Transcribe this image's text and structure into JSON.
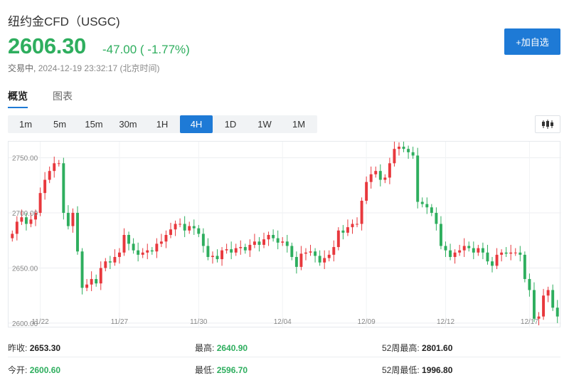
{
  "header": {
    "title": "纽约金CFD（USGC)",
    "price": "2606.30",
    "change": "-47.00 ( -1.77%)",
    "status_label": "交易中,",
    "timestamp": "2024-12-19 23:32:17 (北京时间)",
    "add_button_label": "+加自选"
  },
  "tabs": [
    {
      "label": "概览"
    },
    {
      "label": "图表"
    }
  ],
  "periods": [
    {
      "label": "1m"
    },
    {
      "label": "5m"
    },
    {
      "label": "15m"
    },
    {
      "label": "30m"
    },
    {
      "label": "1H"
    },
    {
      "label": "4H"
    },
    {
      "label": "1D"
    },
    {
      "label": "1W"
    },
    {
      "label": "1M"
    }
  ],
  "active_period": "4H",
  "chart_type_icon": "candlestick-icon",
  "colors": {
    "up": "#e8383d",
    "down": "#2eae5e",
    "accent": "#1e7ad6"
  },
  "stats": {
    "prev_close": {
      "label": "昨收:",
      "value": "2653.30"
    },
    "open": {
      "label": "今开:",
      "value": "2600.60"
    },
    "high": {
      "label": "最高:",
      "value": "2640.90"
    },
    "low": {
      "label": "最低:",
      "value": "2596.70"
    },
    "w52_high": {
      "label": "52周最高:",
      "value": "2801.60"
    },
    "w52_low": {
      "label": "52周最低:",
      "value": "1996.80"
    }
  },
  "chart_data": {
    "type": "candlestick",
    "y_ticks": [
      "2750.00",
      "2700.00",
      "2650.00",
      "2600.00"
    ],
    "y_tick_values": [
      2750,
      2700,
      2650,
      2600
    ],
    "ylim": [
      2598,
      2762
    ],
    "x_ticks": [
      {
        "label": "11/22",
        "index": 6
      },
      {
        "label": "11/27",
        "index": 23
      },
      {
        "label": "11/30",
        "index": 40
      },
      {
        "label": "12/04",
        "index": 58
      },
      {
        "label": "12/09",
        "index": 76
      },
      {
        "label": "12/12",
        "index": 93
      },
      {
        "label": "12/17",
        "index": 111
      },
      {
        "label": "12/1",
        "index": 128
      }
    ],
    "close_path": [
      2681,
      2692,
      2696,
      2690,
      2694,
      2700,
      2718,
      2730,
      2738,
      2745,
      2745,
      2700,
      2688,
      2700,
      2665,
      2632,
      2635,
      2640,
      2636,
      2650,
      2656,
      2655,
      2660,
      2664,
      2680,
      2672,
      2666,
      2662,
      2664,
      2666,
      2665,
      2672,
      2674,
      2680,
      2685,
      2690,
      2690,
      2684,
      2688,
      2686,
      2681,
      2670,
      2660,
      2661,
      2658,
      2666,
      2667,
      2664,
      2668,
      2669,
      2666,
      2671,
      2674,
      2671,
      2676,
      2680,
      2677,
      2673,
      2674,
      2670,
      2660,
      2651,
      2663,
      2664,
      2665,
      2661,
      2655,
      2659,
      2662,
      2669,
      2684,
      2682,
      2687,
      2690,
      2690,
      2711,
      2728,
      2735,
      2738,
      2730,
      2732,
      2745,
      2758,
      2760,
      2758,
      2755,
      2752,
      2710,
      2708,
      2705,
      2700,
      2690,
      2670,
      2666,
      2660,
      2664,
      2666,
      2670,
      2668,
      2664,
      2668,
      2664,
      2656,
      2652,
      2662,
      2664,
      2663,
      2664,
      2664,
      2662,
      2640,
      2630,
      2604,
      2606,
      2625,
      2630,
      2614,
      2606
    ]
  }
}
